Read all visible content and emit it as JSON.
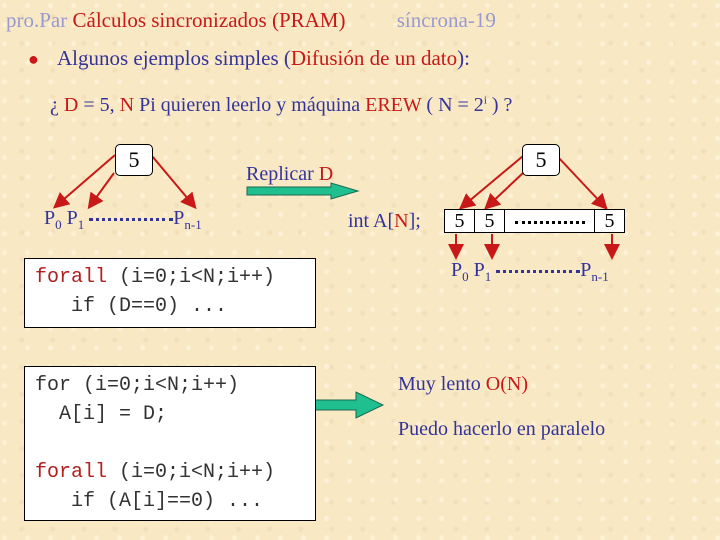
{
  "header": {
    "course": "pro.Par",
    "title": "Cálculos sincronizados (PRAM)",
    "slide_label": "síncrona-19"
  },
  "bullet": {
    "text_pre": "Algunos ejemplos simples (",
    "text_highlight": "Difusión de un dato",
    "text_post": "):"
  },
  "question": {
    "p1": "¿ ",
    "D": "D",
    "p2": " = 5, ",
    "N": "N",
    "p3": " Pi quieren leerlo y máquina ",
    "EREW": "EREW",
    "p4": " ( N = 2",
    "exp": "i",
    "p5": " ) ?"
  },
  "left_diagram": {
    "value": "5",
    "p0": "P",
    "p0_sub": "0",
    "p1": "P",
    "p1_sub": "1",
    "pn": "P",
    "pn_sub": "n-1"
  },
  "replicate": {
    "label": "Replicar ",
    "var": "D"
  },
  "right_diagram": {
    "value": "5",
    "decl_pre": "int A[",
    "decl_N": "N",
    "decl_post": "];",
    "cells": [
      "5",
      "5",
      "5"
    ],
    "p0": "P",
    "p0_sub": "0",
    "p1": "P",
    "p1_sub": "1",
    "pn": "P",
    "pn_sub": "n-1"
  },
  "code1": {
    "line1_kw": "forall",
    "line1_rest": " (i=0;i<N;i++)",
    "line2_pre": "   if (",
    "line2_var": "D",
    "line2_post": "==0) ..."
  },
  "code2": {
    "line1": "for (i=0;i<N;i++)",
    "line2": "  A[i] = D;",
    "line3_kw": "forall",
    "line3_rest": " (i=0;i<N;i++)",
    "line4": "   if (A[i]==0) ..."
  },
  "result": {
    "slow_pre": "Muy lento ",
    "slow_order": "O(N)",
    "parallel": "Puedo hacerlo en paralelo"
  },
  "colors": {
    "background": "#f9e8c4",
    "text_blue": "#33339a",
    "accent_red": "#c81818",
    "arrow_green": "#1fbf8f"
  }
}
